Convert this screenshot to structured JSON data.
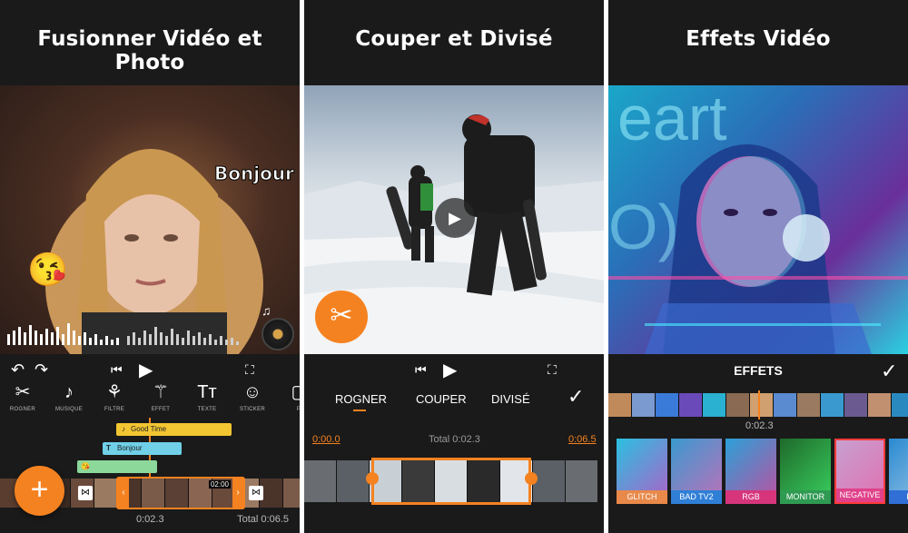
{
  "panel1": {
    "headline": "Fusionner Vidéo et Photo",
    "sticker_text": "Bonjour",
    "emoji": "😘",
    "music_note": "♫",
    "tools": [
      {
        "label": "ROGNER",
        "icon": "scissors-icon",
        "glyph": "✂"
      },
      {
        "label": "MUSIQUE",
        "icon": "music-note-icon",
        "glyph": "♪"
      },
      {
        "label": "FILTRE",
        "icon": "filter-icon",
        "glyph": "⚘"
      },
      {
        "label": "EFFET",
        "icon": "magic-wand-icon",
        "glyph": "⚚"
      },
      {
        "label": "TEXTE",
        "icon": "text-icon",
        "glyph": "Tт"
      },
      {
        "label": "STICKER",
        "icon": "sticker-icon",
        "glyph": "☺"
      },
      {
        "label": "PI",
        "icon": "pip-icon",
        "glyph": "▢"
      }
    ],
    "tracks": {
      "music_label": "Good Time",
      "text_label": "Bonjour",
      "sticker_emoji": "😘"
    },
    "clip_duration": "02:00",
    "current_time": "0:02.3",
    "total_time": "Total 0:06.5",
    "fab_label": "+"
  },
  "panel2": {
    "headline": "Couper et Divisé",
    "tabs": [
      "ROGNER",
      "COUPER",
      "DIVISÉ"
    ],
    "active_tab": "ROGNER",
    "start_time": "0:00.0",
    "total_time": "Total 0:02.3",
    "end_time": "0:06.5"
  },
  "panel3": {
    "headline": "Effets Vidéo",
    "section_title": "EFFETS",
    "current_time": "0:02.3",
    "effects": [
      {
        "label": "GLITCH",
        "color": "#e8894a"
      },
      {
        "label": "BAD TV2",
        "color": "#2f7fd6"
      },
      {
        "label": "RGB",
        "color": "#d6357c"
      },
      {
        "label": "MONITOR",
        "color": "#2f9a52"
      },
      {
        "label": "NEGATIVE",
        "color": "#e0418a"
      },
      {
        "label": "FLO",
        "color": "#2f6fd6"
      }
    ]
  },
  "colors": {
    "accent": "#f58220",
    "background": "#1a1a1a"
  }
}
